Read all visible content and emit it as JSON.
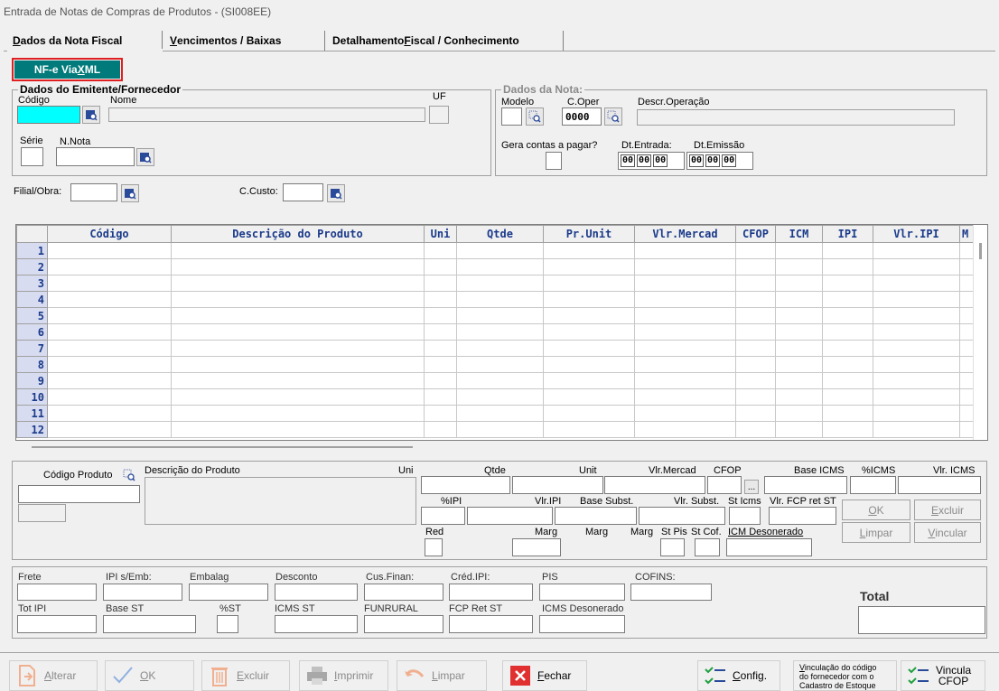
{
  "window": {
    "title": "Entrada de Notas de Compras de Produtos  - (SI008EE)"
  },
  "tabs": [
    {
      "pre": "",
      "u": "D",
      "post": "ados da Nota Fiscal"
    },
    {
      "pre": "",
      "u": "V",
      "post": "encimentos / Baixas"
    },
    {
      "pre": "Detalhamento ",
      "u": "F",
      "post": "iscal / Conhecimento"
    }
  ],
  "nfe_button": {
    "pre": "NF-e Via ",
    "u": "X",
    "post": "ML"
  },
  "emitente": {
    "title": "Dados do Emitente/Fornecedor",
    "codigo_label": "Código",
    "nome_label": "Nome",
    "uf_label": "UF",
    "serie_label": "Série",
    "nnota_label": "N.Nota"
  },
  "nota": {
    "title": "Dados da Nota:",
    "modelo_label": "Modelo",
    "coper_label": "C.Oper",
    "coper_value": "0000",
    "descr_label": "Descr.Operação",
    "gera_label": "Gera contas a pagar?",
    "dtentrada_label": "Dt.Entrada:",
    "dtemissao_label": "Dt.Emissão",
    "dtentrada_segs": [
      "00",
      "00",
      "00"
    ],
    "dtemissao_segs": [
      "00",
      "00",
      "00"
    ]
  },
  "filial_label": "Filial/Obra:",
  "ccusto_label": "C.Custo:",
  "grid": {
    "columns": [
      "Código",
      "Descrição do Produto",
      "Uni",
      "Qtde",
      "Pr.Unit",
      "Vlr.Mercad",
      "CFOP",
      "ICM",
      "IPI",
      "Vlr.IPI",
      "M"
    ],
    "rows": [
      "1",
      "2",
      "3",
      "4",
      "5",
      "6",
      "7",
      "8",
      "9",
      "10",
      "11",
      "12"
    ]
  },
  "detail": {
    "codigo_produto_label": "Código Produto",
    "descricao_label": "Descrição do Produto",
    "uni_label": "Uni",
    "qtde_label": "Qtde",
    "unit_label": "Unit",
    "vlrmercad_label": "Vlr.Mercad",
    "cfop_label": "CFOP",
    "baseicms_label": "Base ICMS",
    "picms_label": "%ICMS",
    "vlricms_label": "Vlr. ICMS",
    "pipi_label": "%IPI",
    "vlripi_label": "Vlr.IPI",
    "basesubst_label": "Base Subst.",
    "vlrsubst_label": "Vlr. Subst.",
    "sticms_label": "St Icms",
    "vlrfcp_label": "Vlr. FCP ret ST",
    "red_label": "Red",
    "marg1_label": "Marg",
    "marg2_label": "Marg",
    "marg3_label": "Marg",
    "stpis_label": "St Pis",
    "stcof_label": "St Cof.",
    "icmdeson_label": "ICM Desonerado",
    "ellipsis": "...",
    "ok_btn": {
      "u": "O",
      "post": "K"
    },
    "excluir_btn": {
      "u": "E",
      "post": "xcluir"
    },
    "limpar_btn": {
      "u": "L",
      "post": "impar"
    },
    "vincular_btn": {
      "u": "V",
      "post": "incular"
    }
  },
  "totals": {
    "frete": "Frete",
    "ipiemb": "IPI s/Emb:",
    "embalag": "Embalag",
    "desconto": "Desconto",
    "cusfinan": "Cus.Finan:",
    "credipi": "Créd.IPI:",
    "pis": "PIS",
    "cofins": "COFINS:",
    "totipi": "Tot IPI",
    "basest": "Base ST",
    "pst": "%ST",
    "icmsst": "ICMS ST",
    "funrural": "FUNRURAL",
    "fcpretst": "FCP Ret ST",
    "icmsdeson": "ICMS Desonerado",
    "total": "Total"
  },
  "toolbar": {
    "alterar": {
      "u": "A",
      "post": "lterar"
    },
    "ok": {
      "u": "O",
      "post": "K"
    },
    "excluir": {
      "u": "E",
      "post": "xcluir"
    },
    "imprimir": {
      "u": "I",
      "post": "mprimir"
    },
    "limpar": {
      "u": "L",
      "post": "impar"
    },
    "fechar": {
      "u": "F",
      "post": "echar"
    },
    "config": {
      "u": "C",
      "post": "onfig."
    },
    "vinculacao": {
      "u": "V",
      "post": "inculação do código",
      "line2": "do fornecedor com o",
      "line3": "Cadastro de Estoque"
    },
    "vincula_cfop": {
      "line1": "Vincula",
      "line2": "CFOP"
    }
  },
  "colors": {
    "accent_teal": "#007a7a",
    "highlight_red": "#e02020",
    "grid_header_text": "#1a3a8a",
    "cyan_field": "#00ffff"
  }
}
